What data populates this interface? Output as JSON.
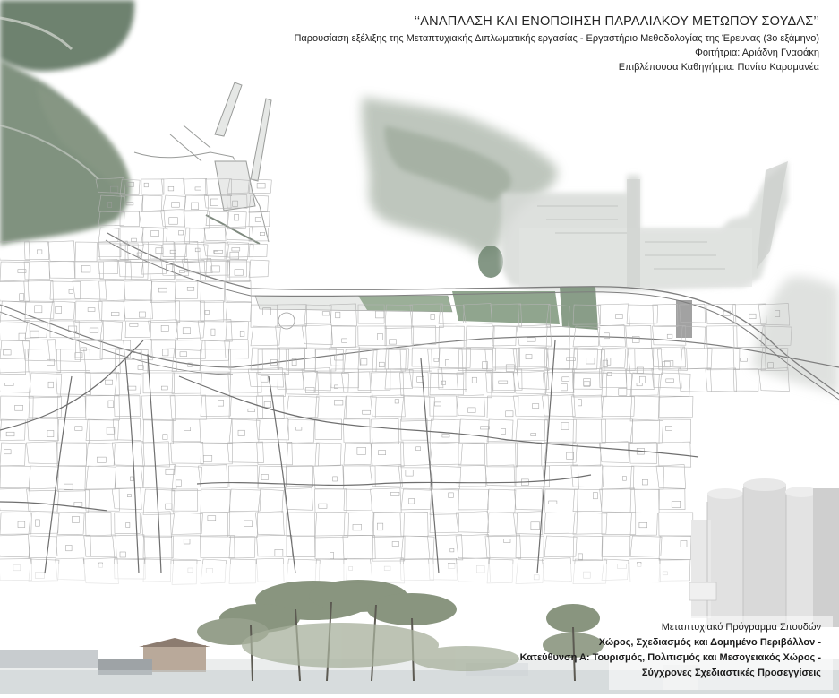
{
  "header": {
    "title": "‘‘ΑΝΑΠΛΑΣΗ ΚΑΙ ΕΝΟΠΟΙΗΣΗ ΠΑΡΑΛΙΑΚΟΥ ΜΕΤΩΠΟΥ ΣΟΥΔΑΣ’’",
    "subtitle": "Παρουσίαση εξέλιξης της Μεταπτυχιακής Διπλωματικής εργασίας - Εργαστήριο Μεθοδολογίας της Έρευνας (3ο εξάμηνο)",
    "student": "Φοιτήτρια: Αριάδνη Γναφάκη",
    "supervisor": "Επιβλέπουσα Καθηγήτρια: Πανίτα Καραμανέα"
  },
  "footer": {
    "line1": "Μεταπτυχιακό Πρόγραμμα Σπουδών",
    "line2": "Χώρος, Σχεδιασμός και Δομημένο Περιβάλλον -",
    "line3": "Κατεύθυνση Α: Τουρισμός, Πολιτισμός και Μεσογειακός Χώρος -",
    "line4": "Σύγχρονες Σχεδιαστικές Προσεγγίσεις"
  },
  "colors": {
    "hill_green": "#5f7560",
    "light_green": "#8fa08c",
    "mist_grey": "#c9cdc9",
    "port_grey": "#dcdedc",
    "street_line": "#8a8a8a",
    "block_line": "#b8b8b8",
    "sky": "#f4f6f6",
    "silo": "#dedede",
    "tree": "#7d8a72"
  }
}
